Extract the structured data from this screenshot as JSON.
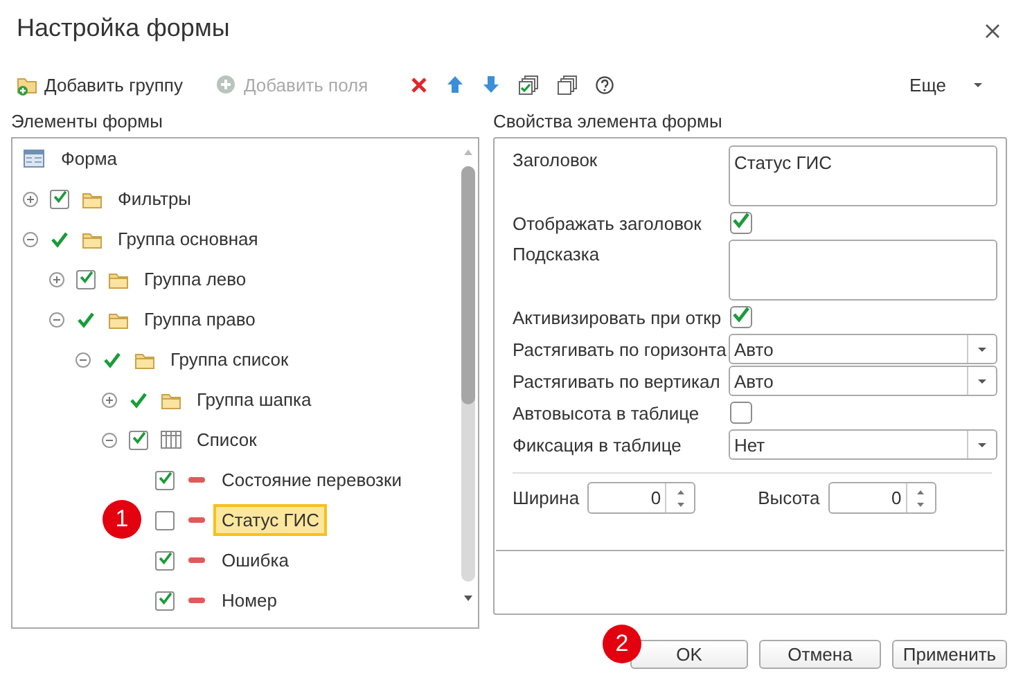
{
  "window": {
    "title": "Настройка формы"
  },
  "toolbar": {
    "buttons": [
      {
        "label": "Добавить группу",
        "disabled": false
      },
      {
        "label": "Добавить поля",
        "disabled": true
      }
    ],
    "more": {
      "label": "Еще"
    }
  },
  "tree": {
    "title": "Элементы формы",
    "root": {
      "label": "Форма",
      "selected": false,
      "children": [
        {
          "label": "Фильтры",
          "expanded": false,
          "boxed": true,
          "checked": true,
          "kind": "folder",
          "selected": false
        },
        {
          "label": "Группа основная",
          "expanded": true,
          "boxed": false,
          "checked": true,
          "kind": "folder",
          "selected": false,
          "children": [
            {
              "label": "Группа лево",
              "expanded": false,
              "boxed": true,
              "checked": true,
              "kind": "folder",
              "selected": false
            },
            {
              "label": "Группа право",
              "expanded": true,
              "boxed": false,
              "checked": true,
              "kind": "folder",
              "selected": false,
              "children": [
                {
                  "label": "Группа список",
                  "expanded": true,
                  "boxed": false,
                  "checked": true,
                  "kind": "folder",
                  "selected": false,
                  "children": [
                    {
                      "label": "Группа шапка",
                      "expanded": false,
                      "boxed": false,
                      "checked": true,
                      "kind": "folder",
                      "selected": false
                    },
                    {
                      "label": "Список",
                      "expanded": true,
                      "boxed": true,
                      "checked": true,
                      "kind": "table",
                      "selected": false,
                      "children": [
                        {
                          "label": "Состояние перевозки",
                          "boxed": true,
                          "checked": true,
                          "kind": "field",
                          "selected": false
                        },
                        {
                          "label": "Статус ГИС",
                          "boxed": true,
                          "checked": false,
                          "kind": "field",
                          "selected": true,
                          "badge": "1"
                        },
                        {
                          "label": "Ошибка",
                          "boxed": true,
                          "checked": true,
                          "kind": "field",
                          "selected": false
                        },
                        {
                          "label": "Номер",
                          "boxed": true,
                          "checked": true,
                          "kind": "field",
                          "selected": false
                        }
                      ]
                    }
                  ]
                }
              ]
            }
          ]
        }
      ]
    }
  },
  "properties": {
    "title": "Свойства элемента формы",
    "rows": [
      {
        "kind": "text",
        "label": "Заголовок",
        "value": "Статус ГИС"
      },
      {
        "kind": "checkbox",
        "label": "Отображать заголовок",
        "checked": true
      },
      {
        "kind": "text",
        "label": "Подсказка"
      },
      {
        "kind": "checkbox",
        "label": "Активизировать при откр",
        "checked": true
      },
      {
        "kind": "select",
        "label": "Растягивать по горизонта",
        "value": "Авто"
      },
      {
        "kind": "select",
        "label": "Растягивать по вертикал",
        "value": "Авто"
      },
      {
        "kind": "checkbox",
        "label": "Автовысота в таблице",
        "checked": false
      },
      {
        "kind": "select",
        "label": "Фиксация в таблице",
        "value": "Нет"
      }
    ],
    "sizes": [
      {
        "label": "Ширина",
        "value": "0"
      },
      {
        "label": "Высота",
        "value": "0"
      }
    ]
  },
  "buttons": [
    {
      "label": "OK",
      "badge": "2"
    },
    {
      "label": "Отмена"
    },
    {
      "label": "Применить"
    }
  ]
}
